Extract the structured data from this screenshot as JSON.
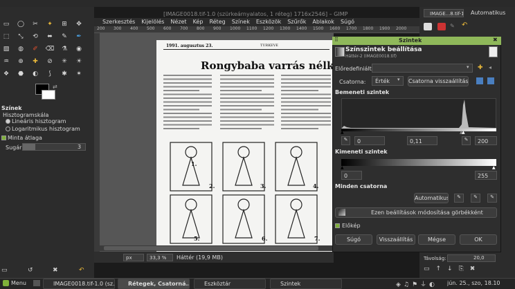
{
  "window": {
    "title_bg": "[IMAGE0018.tif-1.0 (szürkeárnyalatos, 1 réteg) 1716x2546] – GIMP",
    "menu": [
      "Szerkesztés",
      "Kijelölés",
      "Nézet",
      "Kép",
      "Réteg",
      "Színek",
      "Eszközök",
      "Szűrők",
      "Ablakok",
      "Súgó"
    ],
    "ruler_labels": [
      "200",
      "300",
      "400",
      "500",
      "600",
      "700",
      "800",
      "900",
      "1000",
      "1100",
      "1200",
      "1300",
      "1400",
      "1500",
      "1600",
      "1700",
      "1800",
      "1900",
      "2000"
    ]
  },
  "toolbox": {
    "panel_title": "Színek",
    "histogram_label": "Hisztogramskála",
    "linear_label": "Lineáris hisztogram",
    "log_label": "Logaritmikus hisztogram",
    "sample_average_label": "Minta átlaga",
    "radius_label": "Sugár:",
    "radius_value": "3"
  },
  "document": {
    "header_left": "1991. augusztus 23.",
    "header_center": "TÜRKEVE",
    "headline": "Rongybaba varrás nélkül",
    "fig_numbers": [
      "1.",
      "2.",
      "3.",
      "4.",
      "5.",
      "6.",
      "7."
    ]
  },
  "statusbar": {
    "unit": "px",
    "zoom": "33,3 %",
    "layer_info": "Háttér (19,9 MB)"
  },
  "right_dock": {
    "image_select": "IMAGE...8.tif-1",
    "auto_label": "Automatikus",
    "opacity_label": "Távolság:",
    "opacity_value": "20,0"
  },
  "dialog": {
    "title": "Szintek",
    "heading": "Színszintek beállítása",
    "subheading": "Háttér-2 (IMAGE0018.tif)",
    "presets_label": "Előredefiniált:",
    "channel_label": "Csatorna:",
    "channel_value": "Érték",
    "reset_channel_button": "Csatorna visszaállítása",
    "input_levels_title": "Bemeneti szintek",
    "input_black": "0",
    "input_gamma": "0,11",
    "input_white": "200",
    "output_levels_title": "Kimeneti szintek",
    "output_black": "0",
    "output_white": "255",
    "all_channels_title": "Minden csatorna",
    "auto_button": "Automatikus",
    "curves_button": "Ezen beállítások módosítása görbékként",
    "preview_label": "Előkép",
    "help_button": "Súgó",
    "reset_button": "Visszaállítás",
    "cancel_button": "Mégse",
    "ok_button": "OK"
  },
  "taskbar": {
    "menu_label": "Menu",
    "items": [
      "IMAGE0018.tif-1.0 (sz...",
      "Rétegek, Csatorná...",
      "Eszköztár",
      "Szintek"
    ],
    "clock": "jún. 25., szo, 18.10"
  },
  "colors": {
    "accent": "#7fb03a",
    "dialog_bg": "#2e2e2e",
    "canvas_gray": "#565656"
  }
}
